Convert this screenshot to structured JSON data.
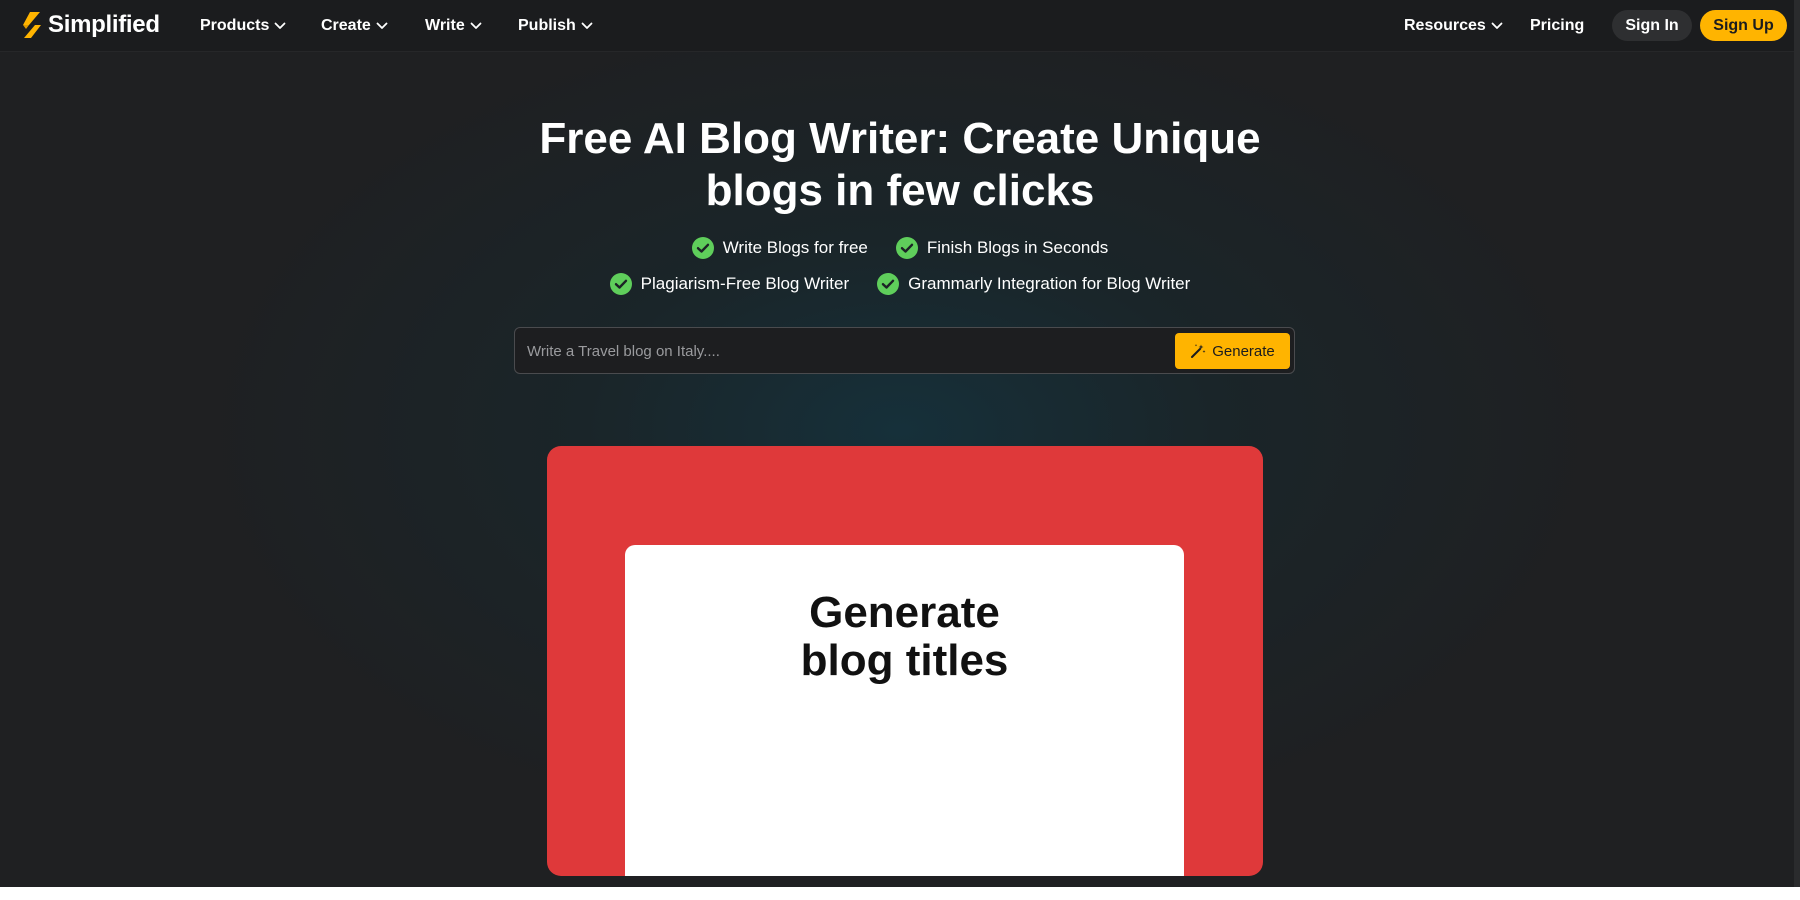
{
  "brand": {
    "name": "Simplified",
    "accent": "#ffb400"
  },
  "nav": {
    "items": [
      {
        "label": "Products",
        "icon": "chevron-down-icon"
      },
      {
        "label": "Create",
        "icon": "chevron-down-icon"
      },
      {
        "label": "Write",
        "icon": "chevron-down-icon"
      },
      {
        "label": "Publish",
        "icon": "chevron-down-icon"
      }
    ],
    "resources": {
      "label": "Resources",
      "icon": "chevron-down-icon"
    },
    "pricing": "Pricing",
    "signin": "Sign In",
    "signup": "Sign Up"
  },
  "hero": {
    "title_line1": "Free AI Blog Writer: Create Unique",
    "title_line2": "blogs in few clicks",
    "features": [
      "Write Blogs for free",
      "Finish Blogs in Seconds",
      "Plagiarism-Free Blog Writer",
      "Grammarly Integration for Blog Writer"
    ],
    "check_color": "#5fce5b"
  },
  "search": {
    "placeholder": "Write a Travel blog on Italy....",
    "value": "",
    "button_label": "Generate",
    "button_icon": "magic-wand-icon"
  },
  "video": {
    "background": "#df393a",
    "title_line1": "Generate",
    "title_line2": "blog titles"
  }
}
